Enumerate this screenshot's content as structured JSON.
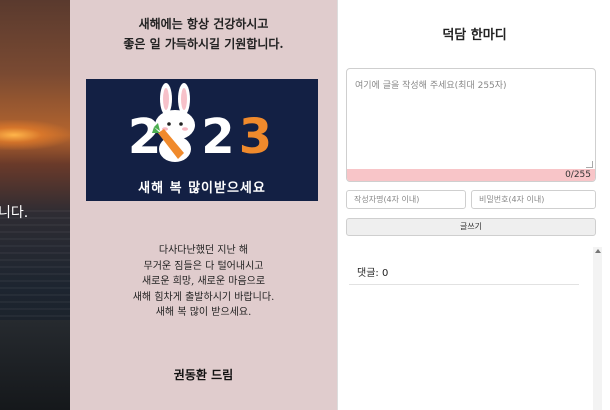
{
  "photo": {
    "message": "니다."
  },
  "card": {
    "greeting": [
      "새해에는 항상 건강하시고",
      "좋은 일 가득하시길 기원합니다."
    ],
    "banner": {
      "year_a": "2",
      "year_b": "2",
      "year_c": "3",
      "wish": "새해 복 많이받으세요"
    },
    "poem": [
      "다사다난했던 지난 해",
      "무거운 짐들은 다 털어내시고",
      "새로운 희망, 새로운 마음으로",
      "새해 힘차게 출발하시기 바랍니다.",
      "새해 복 많이 받으세요."
    ],
    "signature": "권동환 드림"
  },
  "guestbook": {
    "title": "덕담 한마디",
    "textarea_placeholder": "여기에 글을 작성해 주세요(최대 255자)",
    "char_count": "0/255",
    "name_placeholder": "작성자명(4자 이내)",
    "password_placeholder": "비밀번호(4자 이내)",
    "submit_label": "글쓰기",
    "comment_count": "댓글: 0"
  },
  "colors": {
    "card_bg": "#e0cccd",
    "banner_bg": "#132044",
    "accent_orange": "#f08a2c",
    "counter_bg": "#f8c5c8"
  }
}
